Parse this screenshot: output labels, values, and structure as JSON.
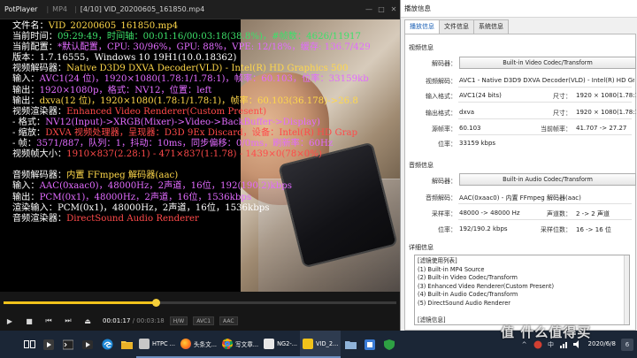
{
  "player": {
    "app_name": "PotPlayer",
    "format": "MP4",
    "title": "[4/10] VID_20200605_161850.mp4",
    "win_min": "—",
    "win_max": "□",
    "win_close": "✕"
  },
  "osd": {
    "l1_label": "文件名：",
    "l1_value": "VID_20200605_161850.mp4",
    "l2_label": "当前时间：",
    "l2_value": "09:29:49，时间轴：00:01:16/00:03:18(38.8%)，#帧数：4626/11917",
    "l3_label": "当前配置：",
    "l3_value": "*默认配置，CPU: 30/96%，GPU: 88%，VPE: 12/18%，缓存: 136.7/429",
    "l4_label": "版本：",
    "l4_value": "1.7.16555，Windows 10 19H1(10.0.18362)",
    "l5_label": "视频解码器：",
    "l5_value": "Native D3D9 DXVA Decoder(VLD) - Intel(R) HD Graphics 500",
    "l6_label": "输入：",
    "l6_value": "AVC1(24 位)，1920×1080(1.78:1/1.78:1)，帧率：60.103，位率：33159kb",
    "l7_label": "输出：",
    "l7_value": "1920×1080p，格式：NV12，位置：left",
    "l8_label": "输出：",
    "l8_value": "dxva(12 位)，1920×1080(1.78:1/1.78:1)，帧率：60.103(36.178)->26.8",
    "l9_label": "视频渲染器：",
    "l9_value": "Enhanced Video Renderer(Custom Present)",
    "l10_label": " - 格式：",
    "l10_value": "NV12(Input)->XRGB(Mixer)->Video->BackBuffer->Display)",
    "l11_label": " - 缩放：",
    "l11_value": "DXVA 视频处理器，呈现器：D3D 9Ex Discard，设备：Intel(R) HD Grap",
    "l12_label": " - 帧：",
    "l12_value": "3571/887，队列：1，抖动：10ms，同步偏移：0/0ms，刷新率：60Hz",
    "l13_label": "视频帧大小：",
    "l13_value": "1910×837(2.28:1) - 471×837(1:1.78) - 1439×0(78×0%)",
    "l14_label": "音频解码器：",
    "l14_value": "内置 FFmpeg 解码器(aac)",
    "l15_label": "输入：",
    "l15_value": "AAC(0xaac0)，48000Hz，2声道，16位，192(190.2)kbps",
    "l16_label": "输出：",
    "l16_value": "PCM(0x1)，48000Hz，2声道，16位，1536kbps",
    "l17_label": "渲染输入：",
    "l17_value": "PCM(0x1)，48000Hz，2声道，16位，1536kbps",
    "l18_label": "音频渲染器：",
    "l18_value": "DirectSound Audio Renderer"
  },
  "controls": {
    "progress": 0.388,
    "current_time": "00:01:17",
    "total_time": "00:03:18",
    "tag1": "H/W",
    "tag2": "AVC1",
    "tag3": "AAC",
    "play_icon": "▶",
    "stop_icon": "■",
    "prev_icon": "⏮",
    "next_icon": "⏭",
    "eject_icon": "⏏"
  },
  "panel": {
    "title": "播放信息",
    "tabs": [
      "播放信息",
      "文件信息",
      "系统信息"
    ],
    "video_section": "视频信息",
    "decoder_label": "解码器：",
    "video_decoder_button": "Built-in Video Codec/Transform",
    "video_codec_label": "视频解码：",
    "video_codec_value": "AVC1 - Native D3D9 DXVA Decoder(VLD) - Intel(R) HD Grap",
    "input_format_label": "输入格式：",
    "input_format_value": "AVC1(24 bits)",
    "size_label": "尺寸：",
    "size_value": "1920 × 1080(1.78:1)",
    "output_format_label": "输出格式：",
    "output_format_value": "dxva",
    "size2_label": "尺寸：",
    "size2_value": "1920 × 1080(1.78:1)",
    "source_fps_label": "源帧率：",
    "source_fps_value": "60.103",
    "current_fps_label": "当前帧率：",
    "current_fps_value": "41.707 -> 27.27",
    "bitrate_label": "位率：",
    "bitrate_value": "33159 kbps",
    "audio_section": "音频信息",
    "audio_decoder_label": "解码器：",
    "audio_decoder_button": "Built-in Audio Codec/Transform",
    "audio_codec_label": "音频解码：",
    "audio_codec_value": "AAC(0xaac0) - 内置 FFmpeg 解码器(aac)",
    "sample_rate_label": "采样率：",
    "sample_rate_value": "48000 -> 48000 Hz",
    "channels_label": "声道数：",
    "channels_value": "2 -> 2 声道",
    "audio_bitrate_label": "位率：",
    "audio_bitrate_value": "192/190.2 kbps",
    "sample_bits_label": "采样位数：",
    "sample_bits_value": "16 -> 16 位",
    "detail_section": "详细信息",
    "detail_lines": [
      "[滤镜使用列表]",
      "(1) Built-in MP4 Source",
      "(2) Built-in Video Codec/Transform",
      "(3) Enhanced Video Renderer(Custom Present)",
      "(4) Built-in Audio Codec/Transform",
      "(5) DirectSound Audio Renderer",
      "",
      "[滤镜信息]"
    ]
  },
  "taskbar": {
    "apps": [
      {
        "label": "HTPC ..."
      },
      {
        "label": "头条文..."
      },
      {
        "label": "写文章..."
      },
      {
        "label": "NG2-..."
      },
      {
        "label": "VID_2..."
      }
    ],
    "tray_ime": "中",
    "tray_up": "^",
    "tray_badge": "6",
    "date": "2020/6/8",
    "watermark": "值 什么值得买"
  },
  "colors": {
    "osd_white": "#ffffff",
    "osd_yellow": "#ffd84a",
    "osd_green": "#3de06a",
    "osd_magenta": "#e26bff",
    "osd_red": "#ff4a4a",
    "seek_accent": "#f0c21b",
    "tab_active": "#1a5fb4",
    "taskbar": "#1b2636"
  }
}
